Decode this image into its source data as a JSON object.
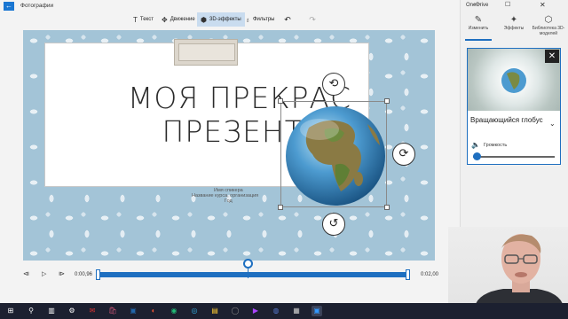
{
  "app": {
    "title": "Фотографии",
    "back_icon": "back-arrow-icon"
  },
  "toolbar": {
    "text_label": "Текст",
    "motion_label": "Движение",
    "effects3d_label": "3D-эффекты",
    "filters_label": "Фильтры",
    "undo_icon": "↶",
    "redo_icon": "↷"
  },
  "slide": {
    "title_line1": "МОЯ ПРЕКРАС",
    "title_line2": "ПРЕЗЕНТА",
    "subtitle_1": "Имя спикера",
    "subtitle_2": "Название курса, организация",
    "subtitle_3": "Год"
  },
  "object3d": {
    "rotate_top": "⟲",
    "rotate_right": "⟳",
    "rotate_bottom": "↺",
    "delete": "✕"
  },
  "timeline": {
    "current_time": "0:00,96",
    "end_time": "0:02,00",
    "prev_icon": "⧏",
    "play_icon": "▷",
    "next_icon": "⧐",
    "playhead_fraction": 0.48
  },
  "panel": {
    "onedrive_label": "OneDrive",
    "tabs": [
      {
        "label": "Изменить",
        "icon": "✎"
      },
      {
        "label": "Эффекты",
        "icon": "✦"
      },
      {
        "label": "Библиотека 3D-моделей",
        "icon": "⬡"
      }
    ],
    "card": {
      "title": "Вращающийся глобус",
      "volume_label": "Громкость",
      "volume_level": 0,
      "close_icon": "✕",
      "expand_icon": "⌄",
      "volume_icon": "🔈"
    }
  },
  "window": {
    "minimize": "—",
    "maximize": "☐",
    "close": "✕"
  },
  "taskbar": {
    "icons": [
      "⊞",
      "⚲",
      "▥",
      "⚙",
      "✉",
      "🛍",
      "▣",
      "◐",
      "◉",
      "◎",
      "▤",
      "◯",
      "▶",
      "◍",
      "▦",
      "▣"
    ]
  }
}
